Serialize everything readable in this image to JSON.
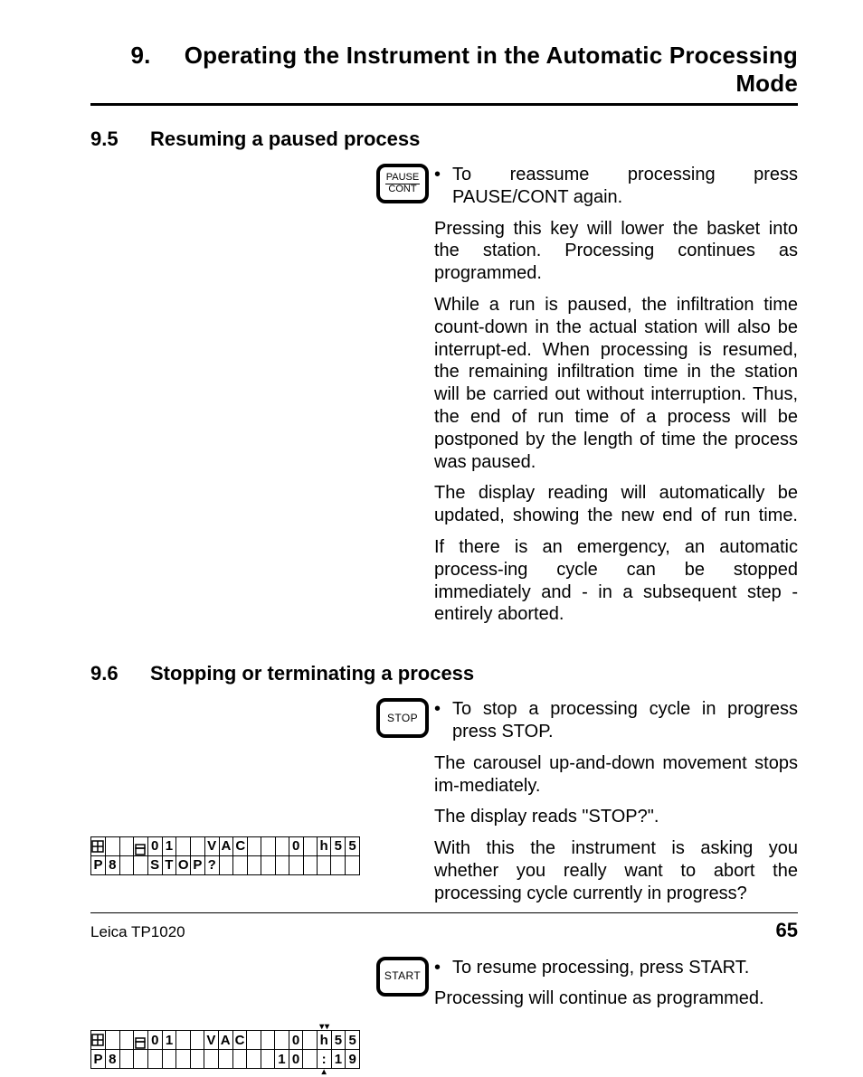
{
  "chapter": {
    "num": "9.",
    "title": "Operating the Instrument in the Automatic Processing Mode"
  },
  "s95": {
    "num": "9.5",
    "title": "Resuming a paused process",
    "key": {
      "line1": "PAUSE",
      "line2": "CONT"
    },
    "bullet1": "To reassume processing press PAUSE/CONT again.",
    "p1": "Pressing this key will lower the basket into the station. Processing continues as programmed.",
    "p2": "While a run is paused, the infiltration time count-down in the actual station will also be interrupt-ed. When processing is resumed, the remaining infiltration time in the station will be carried out without interruption. Thus, the end of run time of a process will be postponed by the length of time the process was paused.",
    "p3": "The display reading will automatically be updated, showing the new end of run time.",
    "p4": "If there is an emergency, an automatic process-ing cycle can be stopped immediately and - in a subsequent step - entirely aborted."
  },
  "s96": {
    "num": "9.6",
    "title": "Stopping or terminating a process",
    "keyStop": "STOP",
    "keyStart": "START",
    "bullet1": "To stop a processing cycle in progress press STOP.",
    "p1": "The carousel up-and-down movement stops im-mediately.",
    "p2": "The display reads \"STOP?\".",
    "p3": "With this the instrument is asking you whether you really want to abort the processing cycle currently in progress?",
    "bullet2": "To resume processing, press START.",
    "p4": "Processing will continue as programmed.",
    "lcd1": {
      "r1": [
        "",
        "",
        "",
        "",
        "0",
        "1",
        "",
        "",
        "V",
        "A",
        "C",
        "",
        "",
        "",
        "0",
        "",
        "h",
        "5",
        "5"
      ],
      "r2": [
        "P",
        "8",
        "",
        "",
        "S",
        "T",
        "O",
        "P",
        "?",
        "",
        "",
        "",
        "",
        "",
        "",
        "",
        "",
        "",
        ""
      ]
    },
    "lcd2": {
      "r1": [
        "",
        "",
        "",
        "",
        "0",
        "1",
        "",
        "",
        "V",
        "A",
        "C",
        "",
        "",
        "",
        "0",
        "",
        "h",
        "5",
        "5"
      ],
      "r2": [
        "P",
        "8",
        "",
        "",
        "",
        "",
        "",
        "",
        "",
        "",
        "",
        "",
        "",
        "1",
        "0",
        "",
        ":",
        "1",
        "9"
      ]
    }
  },
  "footer": {
    "left": "Leica TP1020",
    "page": "65"
  }
}
